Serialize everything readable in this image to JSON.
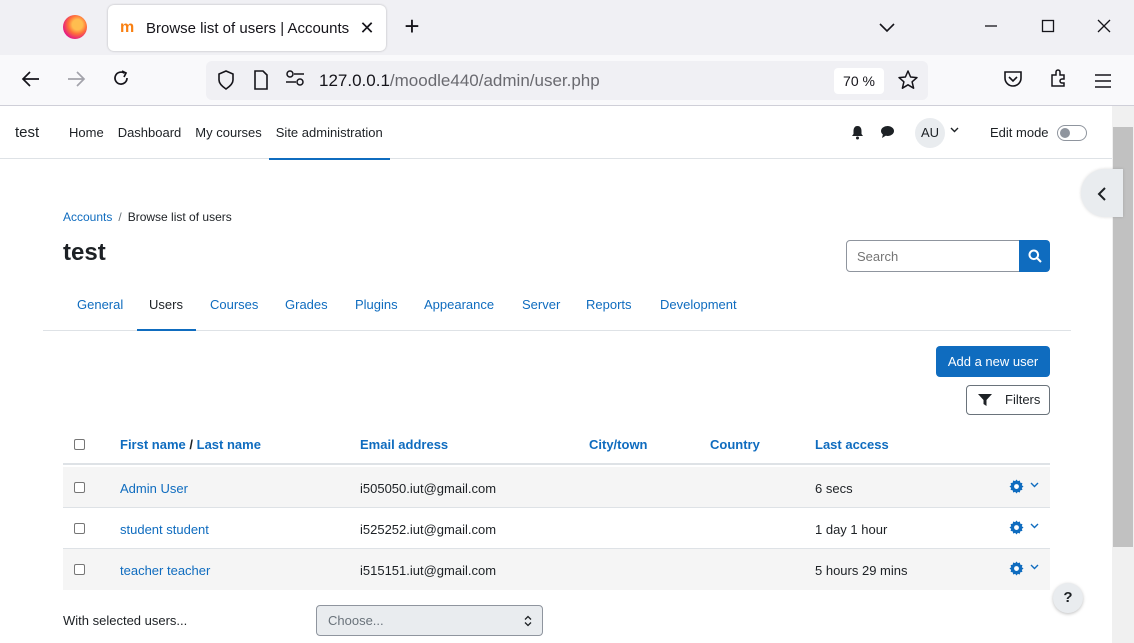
{
  "browser": {
    "tab_title": "Browse list of users | Accounts | test",
    "favicon_glyph": "m",
    "close_glyph": "✕",
    "newtab_glyph": "+",
    "url_host": "127.0.0.1",
    "url_path": "/moodle440/admin/user.php",
    "zoom": "70 %",
    "icons": [
      "firefox-logo",
      "back-arrow",
      "forward-arrow",
      "reload",
      "shield",
      "page",
      "permissions",
      "bookmark-star",
      "pocket",
      "extensions",
      "menu"
    ]
  },
  "header": {
    "site_name": "test",
    "nav": [
      "Home",
      "Dashboard",
      "My courses",
      "Site administration"
    ],
    "avatar_initials": "AU",
    "edit_mode_label": "Edit mode"
  },
  "breadcrumb": {
    "parent": "Accounts",
    "separator": "/",
    "current": "Browse list of users"
  },
  "page_title": "test",
  "search": {
    "placeholder": "Search"
  },
  "tabs": [
    "General",
    "Users",
    "Courses",
    "Grades",
    "Plugins",
    "Appearance",
    "Server",
    "Reports",
    "Development"
  ],
  "actions": {
    "add_user": "Add a new user",
    "filters": "Filters"
  },
  "table": {
    "headers": {
      "first_name": "First name",
      "slash": "/",
      "last_name": "Last name",
      "email": "Email address",
      "city": "City/town",
      "country": "Country",
      "last_access": "Last access"
    },
    "rows": [
      {
        "name": "Admin User",
        "email": "i505050.iut@gmail.com",
        "city": "",
        "country": "",
        "last_access": "6 secs"
      },
      {
        "name": "student student",
        "email": "i525252.iut@gmail.com",
        "city": "",
        "country": "",
        "last_access": "1 day 1 hour"
      },
      {
        "name": "teacher teacher",
        "email": "i515151.iut@gmail.com",
        "city": "",
        "country": "",
        "last_access": "5 hours 29 mins"
      }
    ]
  },
  "bulk": {
    "label": "With selected users...",
    "select_value": "Choose..."
  },
  "help_label": "?",
  "colors": {
    "primary": "#0f6cbf",
    "text": "#1d2125"
  }
}
